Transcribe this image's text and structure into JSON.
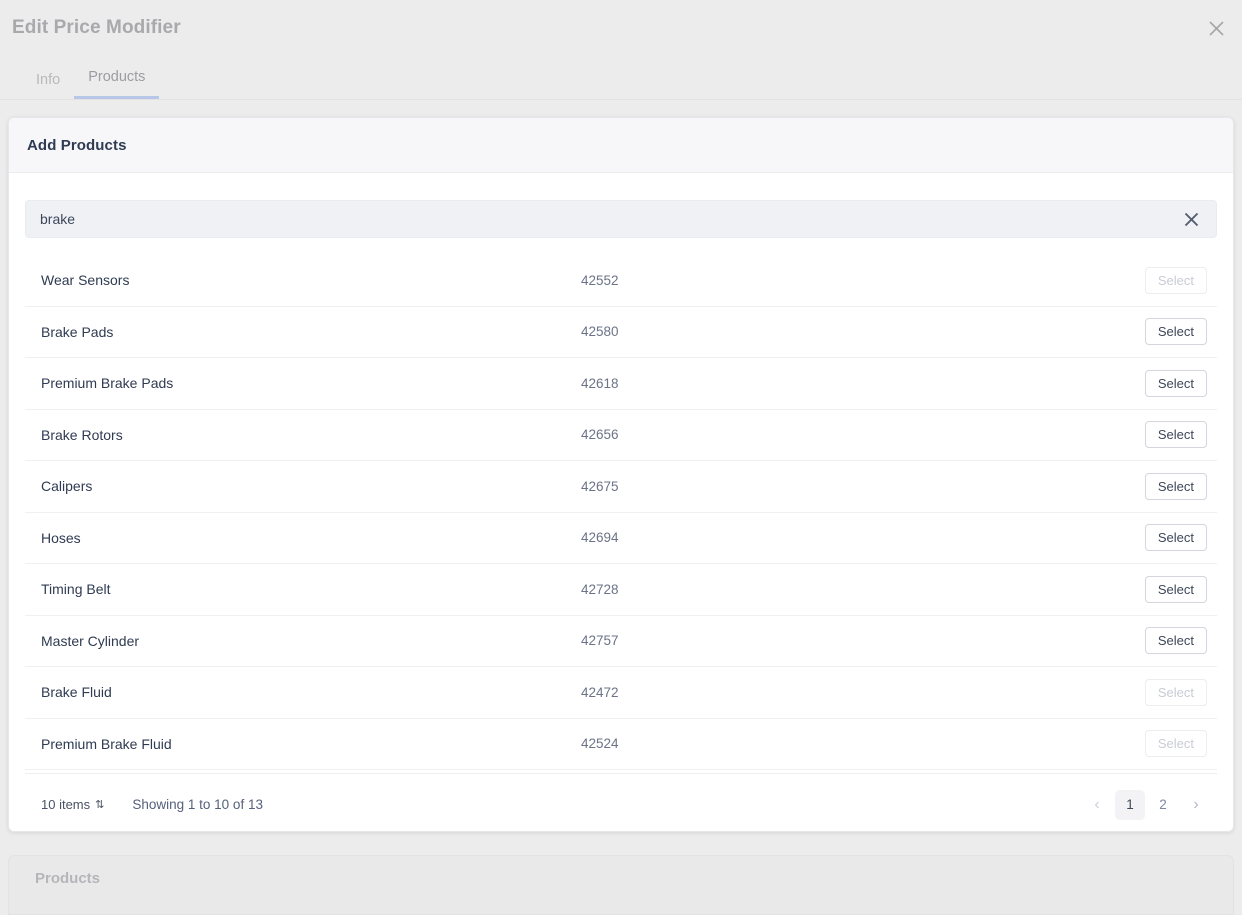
{
  "background": {
    "title": "Edit Price Modifier",
    "close_icon": "close-icon",
    "tabs": [
      {
        "label": "Info",
        "active": false
      },
      {
        "label": "Products",
        "active": true
      }
    ],
    "bottom_panel_title": "Products"
  },
  "modal": {
    "title": "Add Products",
    "search": {
      "value": "brake",
      "placeholder": "",
      "clear_icon": "close-icon"
    },
    "rows": [
      {
        "name": "Wear Sensors",
        "sku": "42552",
        "action": "Select",
        "disabled": true
      },
      {
        "name": "Brake Pads",
        "sku": "42580",
        "action": "Select",
        "disabled": false
      },
      {
        "name": "Premium Brake Pads",
        "sku": "42618",
        "action": "Select",
        "disabled": false
      },
      {
        "name": "Brake Rotors",
        "sku": "42656",
        "action": "Select",
        "disabled": false
      },
      {
        "name": "Calipers",
        "sku": "42675",
        "action": "Select",
        "disabled": false
      },
      {
        "name": "Hoses",
        "sku": "42694",
        "action": "Select",
        "disabled": false
      },
      {
        "name": "Timing Belt",
        "sku": "42728",
        "action": "Select",
        "disabled": false
      },
      {
        "name": "Master Cylinder",
        "sku": "42757",
        "action": "Select",
        "disabled": false
      },
      {
        "name": "Brake Fluid",
        "sku": "42472",
        "action": "Select",
        "disabled": true
      },
      {
        "name": "Premium Brake Fluid",
        "sku": "42524",
        "action": "Select",
        "disabled": true
      }
    ],
    "footer": {
      "items_per_page": "10 items",
      "items_arrow": "⇅",
      "showing": "Showing 1 to 10 of 13",
      "pagination": {
        "prev_icon": "chevron-left-icon",
        "next_icon": "chevron-right-icon",
        "pages": [
          "1",
          "2"
        ],
        "current": "1"
      }
    }
  },
  "colors": {
    "accent": "#b8c6e8",
    "text_primary": "#2f3b52",
    "text_muted": "#6b7386",
    "page_bg": "#ececec",
    "card_bg": "#ffffff",
    "input_bg": "#eff1f5"
  }
}
